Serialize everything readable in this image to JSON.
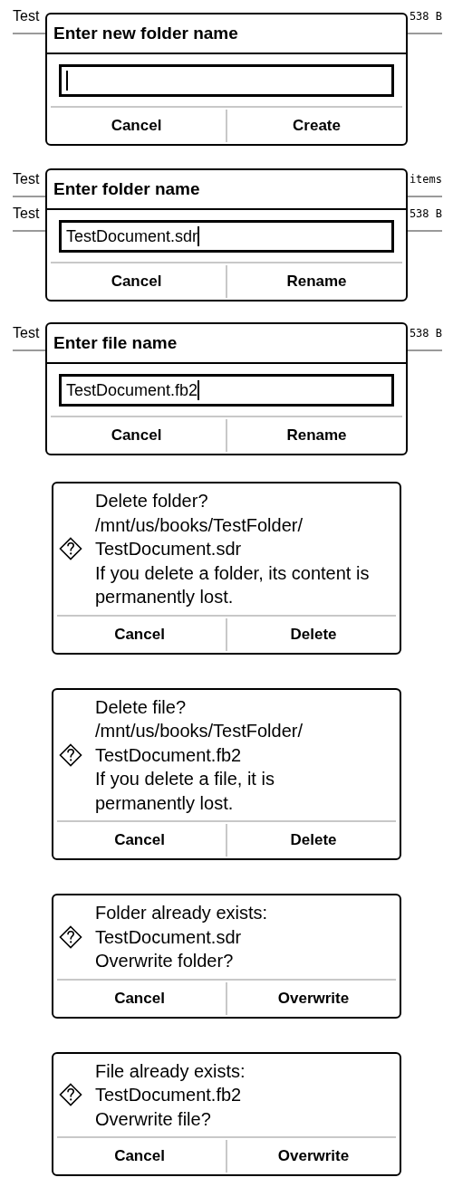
{
  "sections": [
    {
      "kind": "input",
      "background_rows": [
        {
          "name": "Test",
          "info": "538 B"
        }
      ],
      "dialog": {
        "title": "Enter new folder name",
        "buttons": [
          "Cancel",
          "Create"
        ]
      }
    },
    {
      "kind": "input",
      "background_rows": [
        {
          "name": "Test",
          "info": "items"
        },
        {
          "name": "Test",
          "info": "538 B"
        }
      ],
      "dialog": {
        "title": "Enter folder name",
        "value": "TestDocument.sdr",
        "buttons": [
          "Cancel",
          "Rename"
        ]
      }
    },
    {
      "kind": "input",
      "background_rows": [
        {
          "name": "Test",
          "info": "538 B"
        }
      ],
      "dialog": {
        "title": "Enter file name",
        "value": "TestDocument.fb2",
        "buttons": [
          "Cancel",
          "Rename"
        ]
      }
    },
    {
      "kind": "confirm",
      "dialog": {
        "lines": [
          "Delete folder?",
          "/mnt/us/books/TestFolder/",
          "TestDocument.sdr",
          "If you delete a folder, its content is permanently lost."
        ],
        "buttons": [
          "Cancel",
          "Delete"
        ]
      }
    },
    {
      "kind": "confirm",
      "dialog": {
        "lines": [
          "Delete file?",
          "/mnt/us/books/TestFolder/",
          "TestDocument.fb2",
          "If you delete a file, it is permanently lost."
        ],
        "buttons": [
          "Cancel",
          "Delete"
        ]
      }
    },
    {
      "kind": "confirm",
      "dialog": {
        "lines": [
          "Folder already exists:",
          "TestDocument.sdr",
          "Overwrite folder?"
        ],
        "buttons": [
          "Cancel",
          "Overwrite"
        ]
      }
    },
    {
      "kind": "confirm",
      "dialog": {
        "lines": [
          "File already exists:",
          "TestDocument.fb2",
          "Overwrite file?"
        ],
        "buttons": [
          "Cancel",
          "Overwrite"
        ]
      }
    }
  ]
}
